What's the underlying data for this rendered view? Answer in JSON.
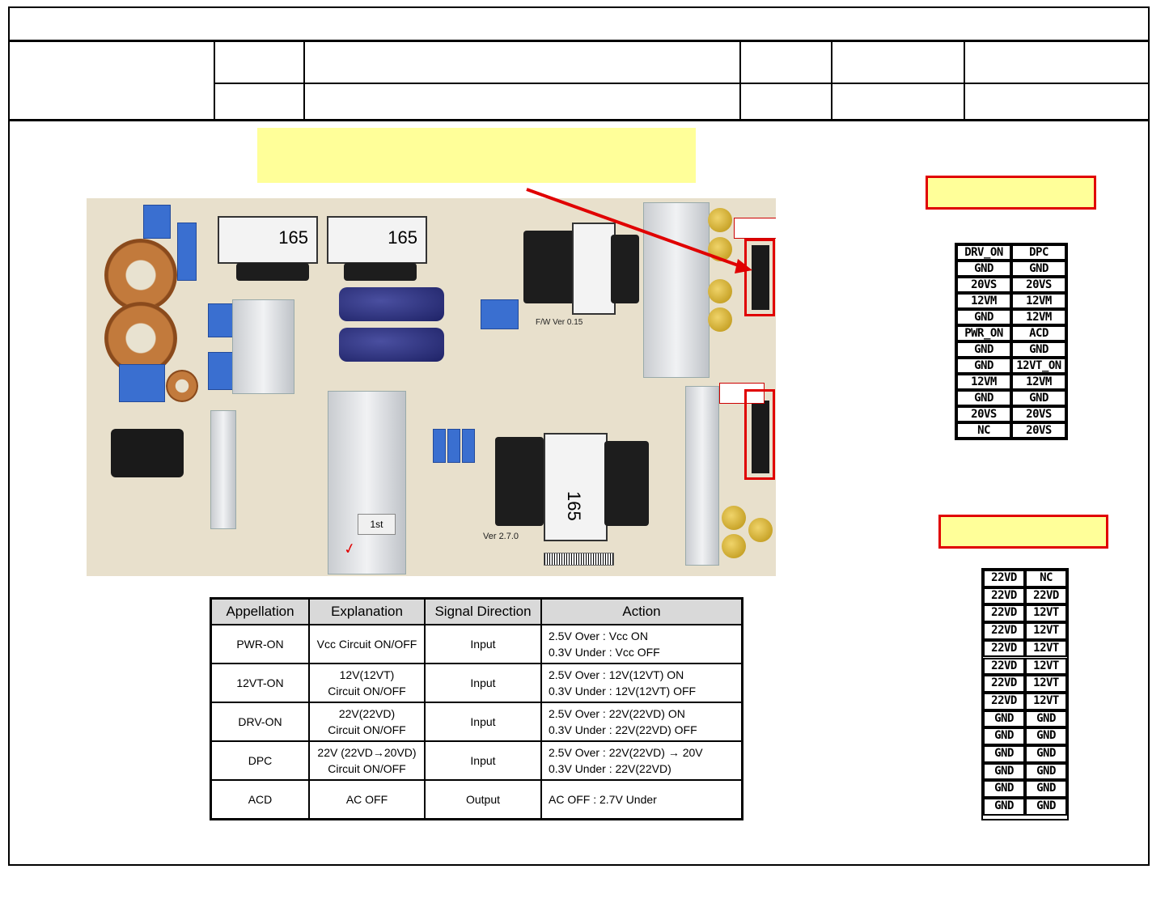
{
  "pcb_photo": {
    "markings": [
      "1st",
      "Ver 2.7.0",
      "F/W Ver 0.15",
      "165",
      "165",
      "165"
    ]
  },
  "signal_table": {
    "headers": [
      "Appellation",
      "Explanation",
      "Signal Direction",
      "Action"
    ],
    "rows": [
      {
        "name": "PWR-ON",
        "explanation": [
          "Vcc Circuit ON/OFF"
        ],
        "direction": "Input",
        "action": [
          "2.5V Over : Vcc ON",
          "0.3V Under : Vcc OFF"
        ]
      },
      {
        "name": "12VT-ON",
        "explanation": [
          "12V(12VT)",
          "Circuit ON/OFF"
        ],
        "direction": "Input",
        "action": [
          "2.5V Over : 12V(12VT) ON",
          "0.3V Under : 12V(12VT) OFF"
        ]
      },
      {
        "name": "DRV-ON",
        "explanation": [
          "22V(22VD)",
          "Circuit ON/OFF"
        ],
        "direction": "Input",
        "action": [
          "2.5V Over : 22V(22VD) ON",
          "0.3V Under : 22V(22VD) OFF"
        ]
      },
      {
        "name": "DPC",
        "explanation": [
          "22V (22VD→20VD)",
          "Circuit ON/OFF"
        ],
        "direction": "Input",
        "action": [
          "2.5V Over : 22V(22VD) → 20V",
          "0.3V Under : 22V(22VD)"
        ]
      },
      {
        "name": "ACD",
        "explanation": [
          "AC OFF"
        ],
        "direction": "Output",
        "action": [
          "AC OFF : 2.7V Under"
        ]
      }
    ]
  },
  "connector_1": {
    "pins": [
      [
        "DRV_ON",
        "DPC"
      ],
      [
        "GND",
        "GND"
      ],
      [
        "20VS",
        "20VS"
      ],
      [
        "12VM",
        "12VM"
      ],
      [
        "GND",
        "12VM"
      ],
      [
        "PWR_ON",
        "ACD"
      ],
      [
        "GND",
        "GND"
      ],
      [
        "GND",
        "12VT_ON"
      ],
      [
        "12VM",
        "12VM"
      ],
      [
        "GND",
        "GND"
      ],
      [
        "20VS",
        "20VS"
      ],
      [
        "NC",
        "20VS"
      ]
    ]
  },
  "connector_2": {
    "pins": [
      [
        "22VD",
        "NC"
      ],
      [
        "22VD",
        "22VD"
      ],
      [
        "22VD",
        "12VT"
      ],
      [
        "22VD",
        "12VT"
      ],
      [
        "22VD",
        "12VT"
      ],
      [
        "22VD",
        "12VT"
      ],
      [
        "22VD",
        "12VT"
      ],
      [
        "22VD",
        "12VT"
      ],
      [
        "GND",
        "GND"
      ],
      [
        "GND",
        "GND"
      ],
      [
        "GND",
        "GND"
      ],
      [
        "GND",
        "GND"
      ],
      [
        "GND",
        "GND"
      ],
      [
        "GND",
        "GND"
      ]
    ]
  },
  "colors": {
    "highlight": "#ffff99",
    "marker": "#e00000"
  }
}
